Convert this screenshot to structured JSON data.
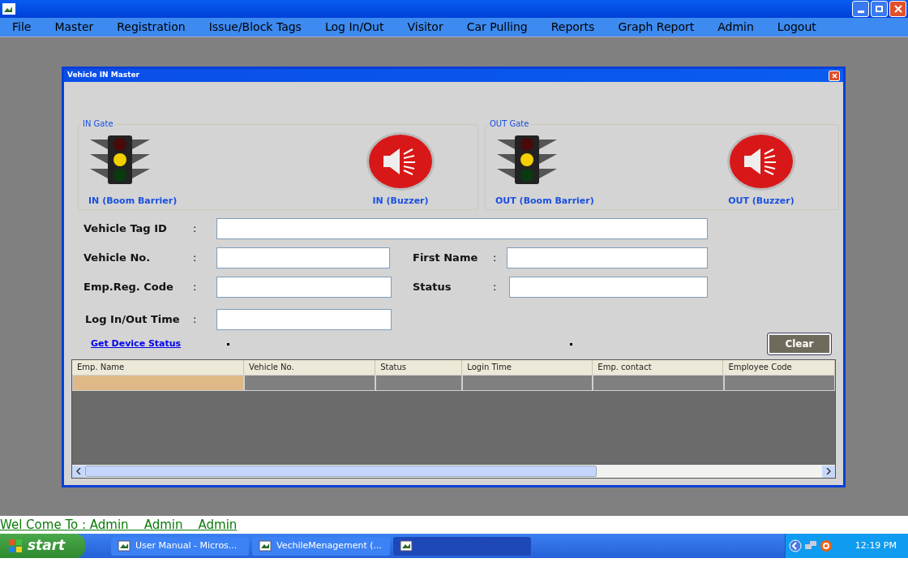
{
  "menu": [
    "File",
    "Master",
    "Registration",
    "Issue/Block Tags",
    "Log In/Out",
    "Visitor",
    "Car Pulling",
    "Reports",
    "Graph Report",
    "Admin",
    "Logout"
  ],
  "dialog": {
    "title": "Vehicle IN Master",
    "gates": [
      {
        "legend": "IN Gate",
        "barrier_label": "IN (Boom Barrier)",
        "buzzer_label": "IN (Buzzer)"
      },
      {
        "legend": "OUT Gate",
        "barrier_label": "OUT (Boom Barrier)",
        "buzzer_label": "OUT (Buzzer)"
      }
    ],
    "fields": {
      "vehicle_tag_id": "Vehicle Tag ID",
      "vehicle_no": "Vehicle No.",
      "first_name": "First Name",
      "emp_reg_code": "Emp.Reg. Code",
      "status": "Status",
      "log_time": "Log In/Out Time"
    },
    "separator": ":",
    "link": "Get Device Status",
    "clear_button": "Clear",
    "table": {
      "columns": [
        "Emp. Name",
        "Vehicle No.",
        "Status",
        "Login Time",
        "Emp. contact",
        "Employee Code"
      ]
    }
  },
  "welcome": "Wel Come To : Admin    Admin    Admin",
  "taskbar": {
    "start": "start",
    "tasks": [
      {
        "label": "User Manual - Micros...",
        "selected": false
      },
      {
        "label": "VechileMenagement (...",
        "selected": false
      },
      {
        "selected": true
      }
    ],
    "clock": "12:19 PM"
  }
}
